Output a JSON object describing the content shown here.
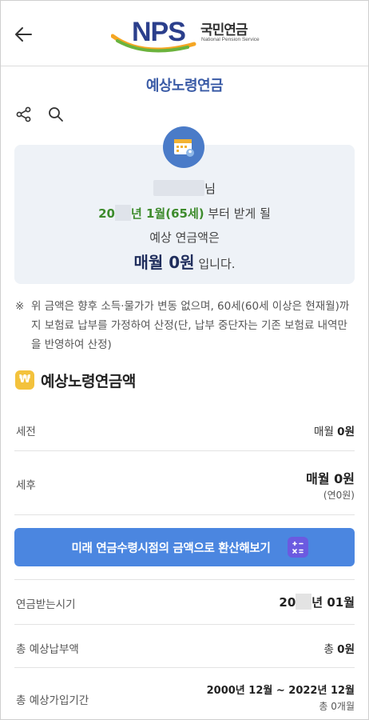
{
  "header": {
    "back_icon": "arrow-left-icon",
    "logo_text": "NPS",
    "logo_korean": "국민연금",
    "logo_english": "National Pension Service"
  },
  "page": {
    "title": "예상노령연금"
  },
  "toolbar": {
    "share_icon": "share-icon",
    "search_icon": "search-icon"
  },
  "summary": {
    "name_suffix": "님",
    "start_year_prefix": "20",
    "start_rest": "년 1월(65세)",
    "start_suffix": " 부터 받게 될",
    "line3": "예상 연금액은",
    "monthly_amount": "매월 0원",
    "monthly_suffix": "입니다."
  },
  "notice": {
    "mark": "※",
    "text": "위 금액은 향후 소득·물가가 변동 없으며, 60세(60세 이상은 현재월)까지 보험료 납부를 가정하여 산정(단, 납부 중단자는 기존 보험료 내역만을 반영하여 산정)"
  },
  "section": {
    "icon_text": "₩",
    "title": "예상노령연금액"
  },
  "rows": {
    "pretax_label": "세전",
    "pretax_prefix": "매월 ",
    "pretax_value": "0원",
    "posttax_label": "세후",
    "posttax_value": "매월 0원",
    "posttax_annual": "(연0원)",
    "receive_label": "연금받는시기",
    "receive_year_prefix": "20",
    "receive_rest": "년 01월",
    "total_paid_label": "총 예상납부액",
    "total_paid_prefix": "총 ",
    "total_paid_value": "0원",
    "period_label": "총 예상가입기간",
    "period_value": "2000년 12월 ~ 2022년 12월",
    "period_months": "총 0개월"
  },
  "convert_button": {
    "label": "미래 연금수령시점의 금액으로 환산해보기",
    "icon": "calculator-icon"
  },
  "colors": {
    "accent": "#4b86e0",
    "title_blue": "#3a5ba6",
    "green": "#3d8b2c",
    "navy": "#1f2d5c",
    "box_bg": "#eef2f7"
  }
}
